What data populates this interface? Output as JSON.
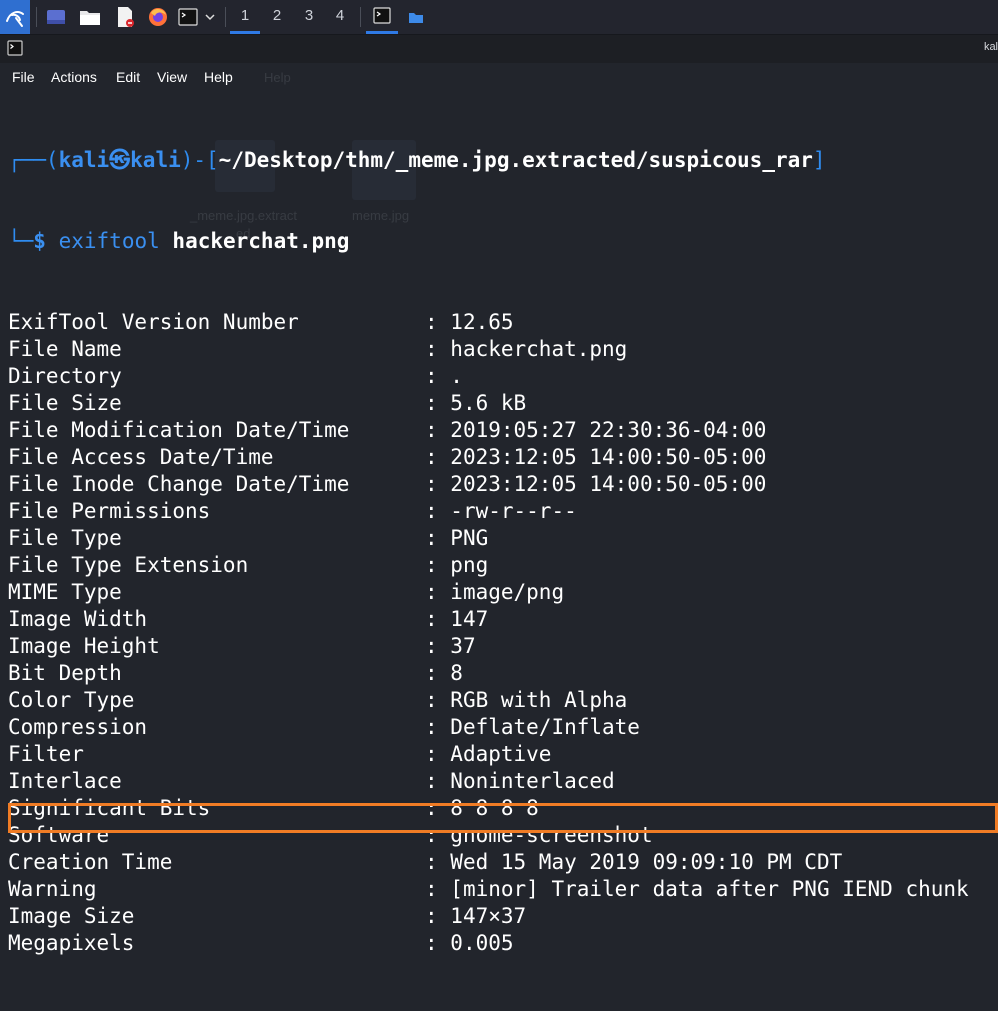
{
  "taskbar": {
    "workspaces": [
      "1",
      "2",
      "3",
      "4"
    ],
    "active_workspace": "1",
    "icons": [
      "kali-menu-icon",
      "show-desktop-icon",
      "file-manager-icon",
      "text-editor-icon",
      "firefox-icon",
      "terminal-icon",
      "chevron-down-icon"
    ]
  },
  "window": {
    "title_short": "kal"
  },
  "menu": {
    "items": [
      "File",
      "Actions",
      "Edit",
      "View",
      "Help"
    ]
  },
  "prompt": {
    "open": "┌──(",
    "user": "kali",
    "at": "㉿",
    "host": "kali",
    "mid": ")-[",
    "path": "~/Desktop/thm/_meme.jpg.extracted/suspicous_rar",
    "close": "]",
    "line2_prefix": "└─",
    "dollar": "$",
    "command": "exiftool",
    "argument": "hackerchat.png"
  },
  "separator": ": ",
  "exif_rows": [
    {
      "key": "ExifTool Version Number",
      "value": "12.65"
    },
    {
      "key": "File Name",
      "value": "hackerchat.png"
    },
    {
      "key": "Directory",
      "value": "."
    },
    {
      "key": "File Size",
      "value": "5.6 kB"
    },
    {
      "key": "File Modification Date/Time",
      "value": "2019:05:27 22:30:36-04:00"
    },
    {
      "key": "File Access Date/Time",
      "value": "2023:12:05 14:00:50-05:00"
    },
    {
      "key": "File Inode Change Date/Time",
      "value": "2023:12:05 14:00:50-05:00"
    },
    {
      "key": "File Permissions",
      "value": "-rw-r--r--"
    },
    {
      "key": "File Type",
      "value": "PNG"
    },
    {
      "key": "File Type Extension",
      "value": "png"
    },
    {
      "key": "MIME Type",
      "value": "image/png"
    },
    {
      "key": "Image Width",
      "value": "147"
    },
    {
      "key": "Image Height",
      "value": "37"
    },
    {
      "key": "Bit Depth",
      "value": "8"
    },
    {
      "key": "Color Type",
      "value": "RGB with Alpha"
    },
    {
      "key": "Compression",
      "value": "Deflate/Inflate"
    },
    {
      "key": "Filter",
      "value": "Adaptive"
    },
    {
      "key": "Interlace",
      "value": "Noninterlaced"
    },
    {
      "key": "Significant Bits",
      "value": "8 8 8 8"
    },
    {
      "key": "Software",
      "value": "gnome-screenshot"
    },
    {
      "key": "Creation Time",
      "value": "Wed 15 May 2019 09:09:10 PM CDT"
    },
    {
      "key": "Warning",
      "value": "[minor] Trailer data after PNG IEND chunk"
    },
    {
      "key": "Image Size",
      "value": "147×37"
    },
    {
      "key": "Megapixels",
      "value": "0.005"
    }
  ],
  "ghost": {
    "folder_label_1": "_meme.jpg.extract",
    "folder_label_2": "ed",
    "file_label": "meme.jpg",
    "menu_ghost": "Help"
  },
  "colors": {
    "highlight": "#f07c25",
    "prompt_blue": "#2f8cf0",
    "background": "#22252c"
  }
}
